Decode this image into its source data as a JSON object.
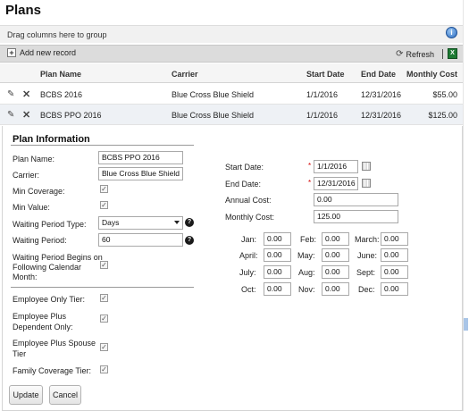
{
  "page": {
    "title": "Plans"
  },
  "grid": {
    "group_hint": "Drag columns here to group",
    "toolbar": {
      "add_label": "Add new record",
      "refresh_label": "Refresh"
    },
    "columns": [
      "Plan Name",
      "Carrier",
      "Start Date",
      "End Date",
      "Monthly Cost"
    ],
    "rows": [
      {
        "plan_name": "BCBS 2016",
        "carrier": "Blue Cross Blue Shield",
        "start": "1/1/2016",
        "end": "12/31/2016",
        "cost": "$55.00"
      },
      {
        "plan_name": "BCBS PPO 2016",
        "carrier": "Blue Cross Blue Shield",
        "start": "1/1/2016",
        "end": "12/31/2016",
        "cost": "$125.00"
      }
    ]
  },
  "form": {
    "section_title": "Plan Information",
    "plan_name_label": "Plan Name:",
    "plan_name_value": "BCBS PPO 2016",
    "carrier_label": "Carrier:",
    "carrier_value": "Blue Cross Blue Shield",
    "min_coverage_label": "Min Coverage:",
    "min_value_label": "Min Value:",
    "waiting_type_label": "Waiting Period Type:",
    "waiting_type_value": "Days",
    "waiting_period_label": "Waiting Period:",
    "waiting_period_value": "60",
    "waiting_begins_label_1": "Waiting Period Begins on",
    "waiting_begins_label_2": "Following Calendar",
    "waiting_begins_label_3": "Month:",
    "emp_only_label": "Employee Only Tier:",
    "emp_dep_label_1": "Employee Plus",
    "emp_dep_label_2": "Dependent Only:",
    "emp_spouse_label_1": "Employee Plus Spouse",
    "emp_spouse_label_2": "Tier",
    "family_label": "Family Coverage Tier:",
    "start_date_label": "Start Date:",
    "start_date_value": "1/1/2016",
    "end_date_label": "End Date:",
    "end_date_value": "12/31/2016",
    "annual_cost_label": "Annual Cost:",
    "annual_cost_value": "0.00",
    "monthly_cost_label": "Monthly Cost:",
    "monthly_cost_value": "125.00",
    "required_mark": "*",
    "check_mark": "✓",
    "help_mark": "?",
    "months": [
      {
        "label": "Jan:",
        "value": "0.00"
      },
      {
        "label": "Feb:",
        "value": "0.00"
      },
      {
        "label": "March:",
        "value": "0.00"
      },
      {
        "label": "April:",
        "value": "0.00"
      },
      {
        "label": "May:",
        "value": "0.00"
      },
      {
        "label": "June:",
        "value": "0.00"
      },
      {
        "label": "July:",
        "value": "0.00"
      },
      {
        "label": "Aug:",
        "value": "0.00"
      },
      {
        "label": "Sept:",
        "value": "0.00"
      },
      {
        "label": "Oct:",
        "value": "0.00"
      },
      {
        "label": "Nov:",
        "value": "0.00"
      },
      {
        "label": "Dec:",
        "value": "0.00"
      }
    ],
    "update_label": "Update",
    "cancel_label": "Cancel"
  },
  "icons": {
    "help": "help-circle-icon",
    "add": "plus-icon",
    "refresh": "refresh-icon",
    "export": "excel-export-icon",
    "edit": "pencil-icon",
    "delete": "close-icon",
    "calendar": "calendar-icon",
    "question": "question-icon"
  },
  "colors": {
    "selected_row": "#eef1f5",
    "toolbar": "#dcdcdc",
    "required": "#d40000"
  }
}
